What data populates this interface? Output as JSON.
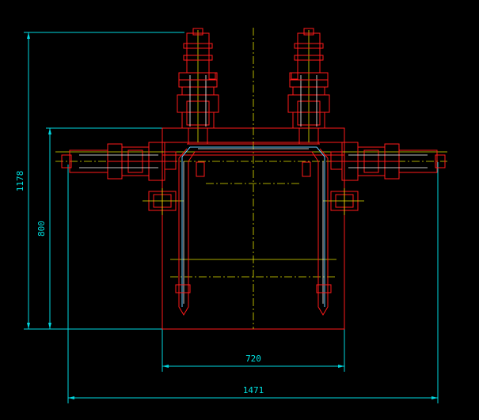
{
  "drawing": {
    "background": "#000000",
    "colors": {
      "dimension": "#00d7e0",
      "outline": "#ff1a1a",
      "centerline": "#e0e000",
      "detail": "#ffffff",
      "frame": "#66ccff"
    }
  },
  "dimensions": {
    "overall_height": "1178",
    "frame_height": "800",
    "frame_width": "720",
    "overall_width": "1471"
  }
}
